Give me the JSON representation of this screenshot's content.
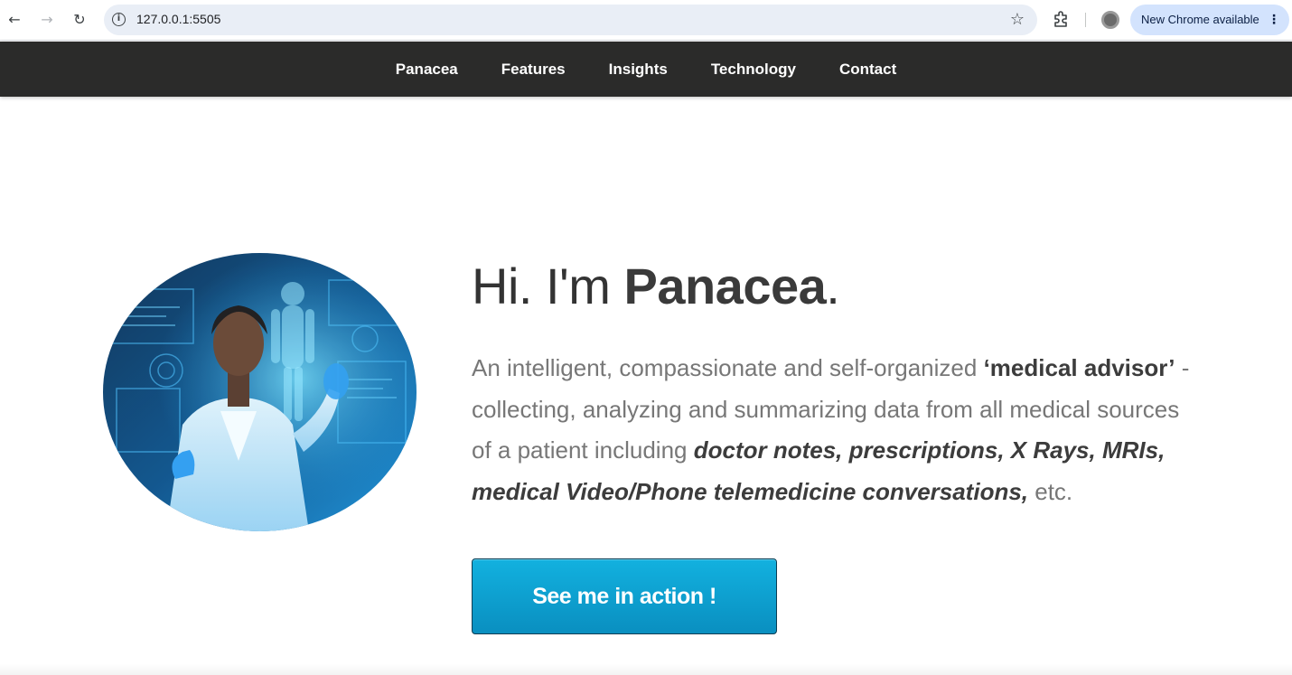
{
  "browser": {
    "url": "127.0.0.1:5505",
    "update_label": "New Chrome available",
    "icons": [
      "back-arrow-icon",
      "forward-arrow-icon",
      "reload-icon",
      "info-icon",
      "star-icon",
      "extensions-icon",
      "profile-icon",
      "kebab-menu-icon"
    ]
  },
  "nav": {
    "items": [
      {
        "label": "Panacea"
      },
      {
        "label": "Features"
      },
      {
        "label": "Insights"
      },
      {
        "label": "Technology"
      },
      {
        "label": "Contact"
      }
    ]
  },
  "hero": {
    "title_prefix": "Hi. I'm ",
    "title_name": "Panacea",
    "title_suffix": ".",
    "desc_1": "An intelligent, compassionate and self-organized ",
    "desc_em": "‘medical advisor’",
    "desc_2": " - collecting, analyzing and summarizing data from all medical sources of a patient including ",
    "desc_emi": "doctor notes, prescriptions, X Rays, MRIs, medical Video/Phone telemedicine conversations,",
    "desc_3": " etc.",
    "cta_label": "See me in action !"
  },
  "colors": {
    "nav_bg": "#2b2b2a",
    "cta_top": "#12b1df",
    "cta_bottom": "#0a8fc0"
  }
}
